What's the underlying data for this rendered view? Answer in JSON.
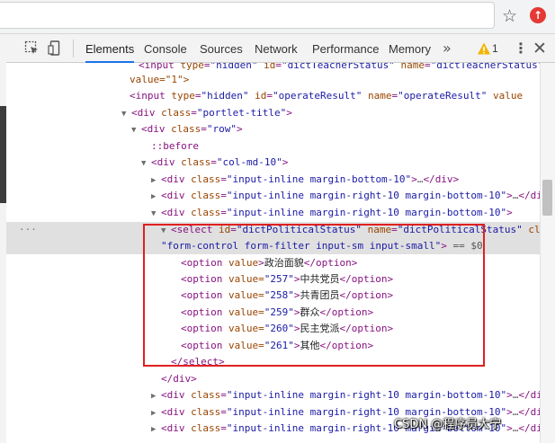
{
  "devtools": {
    "tabs": [
      {
        "label": "Elements"
      },
      {
        "label": "Console"
      },
      {
        "label": "Sources"
      },
      {
        "label": "Network"
      },
      {
        "label": "Performance"
      },
      {
        "label": "Memory"
      }
    ],
    "more_tabs": "»",
    "warning_count": "1",
    "more_icon": "⋮",
    "close_icon": "✕"
  },
  "colors": {
    "highlight_border": "#e02020",
    "tag": "#881280",
    "attr_name": "#994500",
    "attr_value": "#1a1aa6"
  },
  "code": {
    "l0": {
      "t": "input",
      "a1": "type",
      "v1": "\"hidden\"",
      "a2": "id",
      "v2": "\"dictTeacherStatus\"",
      "a3": "name",
      "v3": "\"dictTeacherStatus\""
    },
    "l1": {
      "v": "value=\"1\">"
    },
    "l2": {
      "t": "input",
      "a1": "type",
      "v1": "\"hidden\"",
      "a2": "id",
      "v2": "\"operateResult\"",
      "a3": "name",
      "v3": "\"operateResult\"",
      "a4": "value"
    },
    "l3": {
      "t": "div",
      "a1": "class",
      "v1": "\"portlet-title\""
    },
    "l4": {
      "t": "div",
      "a1": "class",
      "v1": "\"row\""
    },
    "l5": {
      "pseudo": "::before"
    },
    "l6": {
      "t": "div",
      "a1": "class",
      "v1": "\"col-md-10\""
    },
    "l7": {
      "t": "div",
      "a1": "class",
      "v1": "\"input-inline margin-bottom-10\"",
      "ellipsis": "…",
      "close": "div"
    },
    "l8": {
      "t": "div",
      "a1": "class",
      "v1": "\"input-inline margin-right-10 margin-bottom-10\"",
      "ellipsis": "…",
      "close": "div"
    },
    "l9": {
      "t": "div",
      "a1": "class",
      "v1": "\"input-inline margin-right-10 margin-bottom-10\""
    },
    "l10": {
      "t": "select",
      "a1": "id",
      "v1": "\"dictPoliticalStatus\"",
      "a2": "name",
      "v2": "\"dictPoliticalStatus\"",
      "a3": "class="
    },
    "l11": {
      "v1": "\"form-control form-filter input-sm input-small\"",
      "eq": "== $0"
    },
    "options": [
      {
        "attr": "value",
        "val": "",
        "text": "政治面貌"
      },
      {
        "attr": "value=",
        "val": "\"257\"",
        "text": "中共党员"
      },
      {
        "attr": "value=",
        "val": "\"258\"",
        "text": "共青团员"
      },
      {
        "attr": "value=",
        "val": "\"259\"",
        "text": "群众"
      },
      {
        "attr": "value=",
        "val": "\"260\"",
        "text": "民主党派"
      },
      {
        "attr": "value=",
        "val": "\"261\"",
        "text": "其他"
      }
    ],
    "option_tag": "option",
    "close_select": "select",
    "close_div": "div",
    "tail": [
      {
        "t": "div",
        "a1": "class",
        "v1": "\"input-inline margin-right-10 margin-bottom-10\"",
        "ellipsis": "…",
        "close": "div"
      },
      {
        "t": "div",
        "a1": "class",
        "v1": "\"input-inline margin-right-10 margin-bottom-10\"",
        "ellipsis": "…",
        "close": "div"
      },
      {
        "t": "div",
        "a1": "class",
        "v1": "\"input-inline margin-right-10 margin-bottom-10\"",
        "ellipsis": "…",
        "close": "div"
      }
    ]
  },
  "watermark": "CSDN @程序员大宁"
}
